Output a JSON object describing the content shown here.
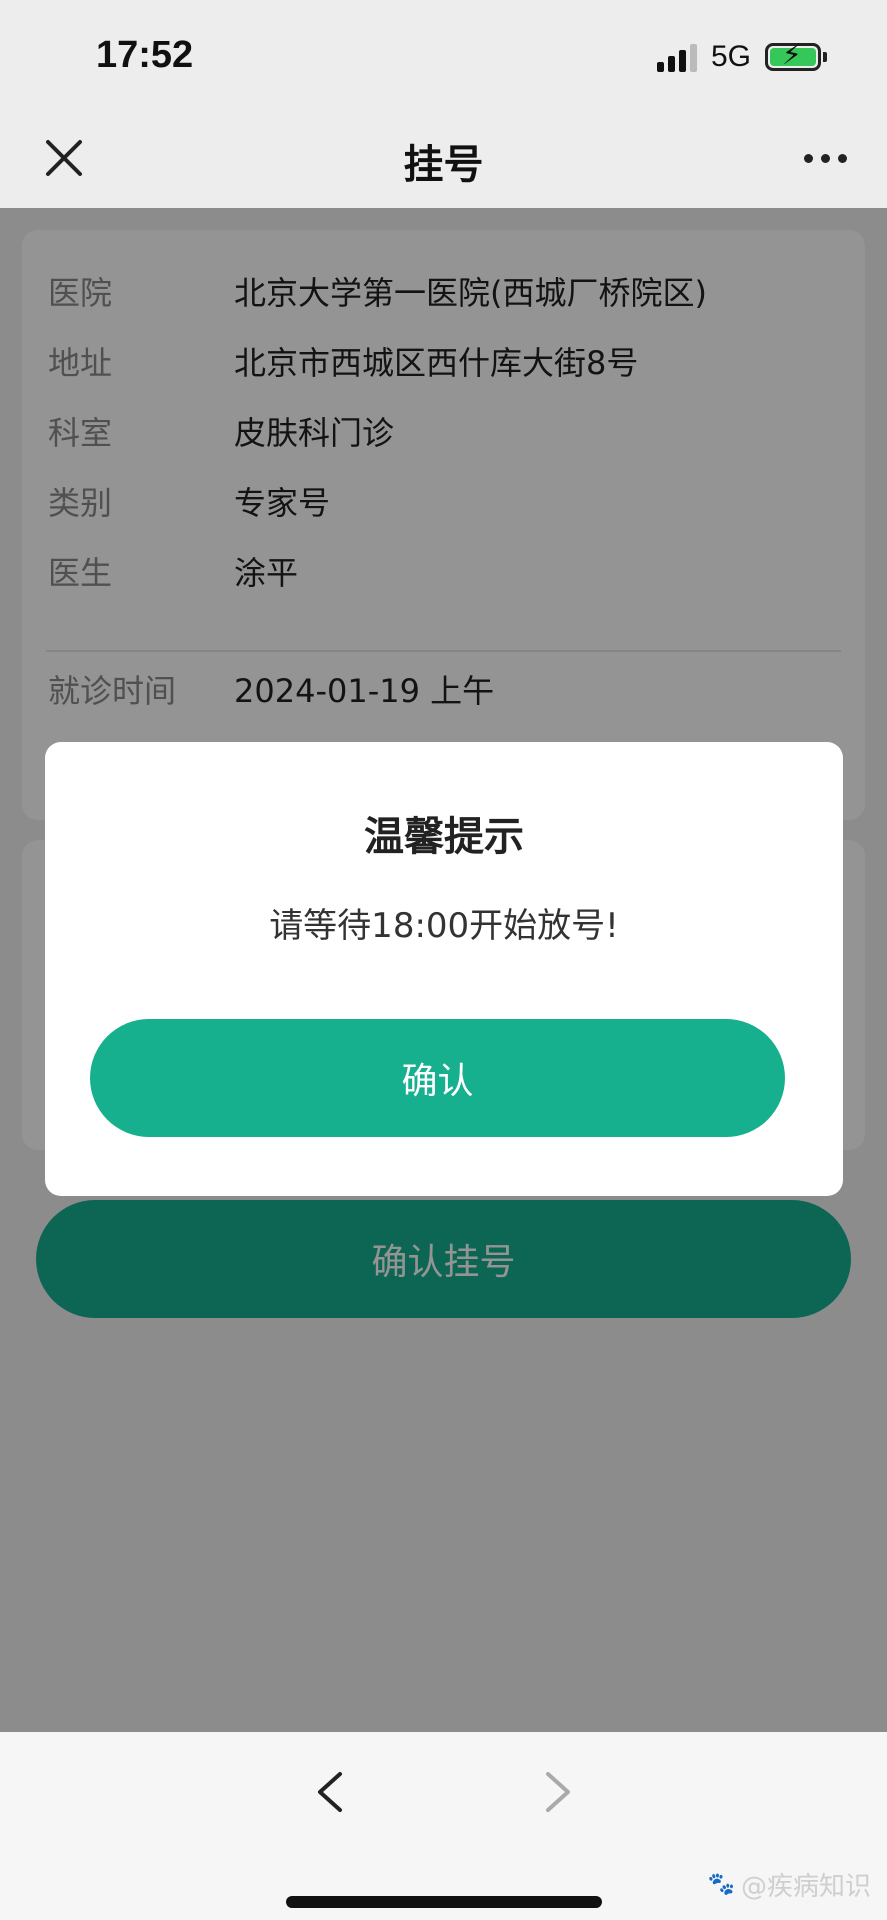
{
  "status_bar": {
    "time": "17:52",
    "network": "5G"
  },
  "nav": {
    "title": "挂号"
  },
  "info_card": {
    "rows": [
      {
        "label": "医院",
        "value": "北京大学第一医院(西城厂桥院区)"
      },
      {
        "label": "地址",
        "value": "北京市西城区西什库大街8号"
      },
      {
        "label": "科室",
        "value": "皮肤科门诊"
      },
      {
        "label": "类别",
        "value": "专家号"
      },
      {
        "label": "医生",
        "value": "涂平"
      }
    ],
    "visit_time": {
      "label": "就诊时间",
      "value": "2024-01-19 上午"
    }
  },
  "primary_button": {
    "label": "确认挂号"
  },
  "dialog": {
    "title": "温馨提示",
    "message": "请等待18:00开始放号!",
    "confirm_label": "确认"
  },
  "watermark": {
    "text": "@疾病知识"
  },
  "colors": {
    "accent": "#17b08f",
    "overlay": "rgba(0,0,0,0.42)"
  }
}
